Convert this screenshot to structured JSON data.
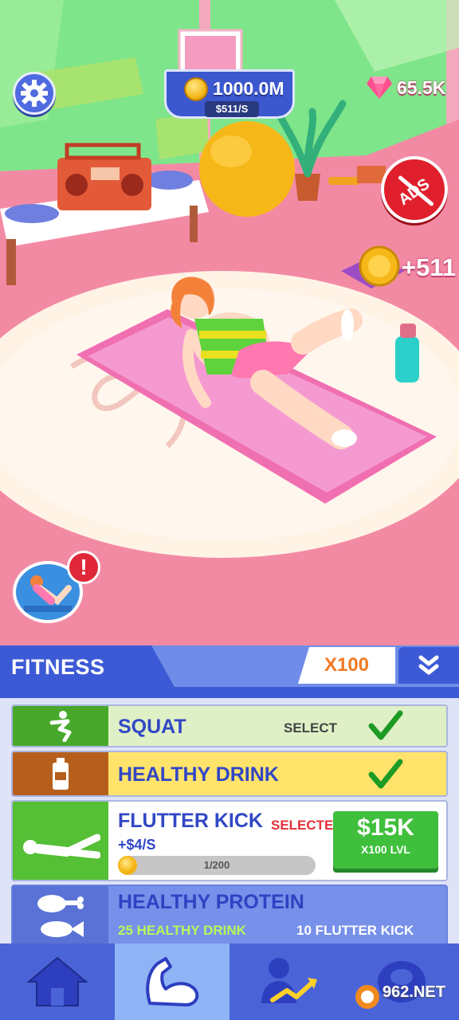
{
  "hud": {
    "coins": "1000.0M",
    "coins_per_second": "$511/S",
    "gems": "65.5K",
    "ads_label": "ADS",
    "income_popup": "+511"
  },
  "panel": {
    "tab_title": "FITNESS",
    "multiplier": "X100",
    "items": [
      {
        "name": "SQUAT",
        "status": "SELECT",
        "icon": "squat-icon",
        "color": "#47a82b"
      },
      {
        "name": "HEALTHY DRINK",
        "icon": "drink-bottle-icon",
        "color": "#b65f1c"
      },
      {
        "name": "FLUTTER KICK",
        "status": "SELECTED",
        "rate": "+$4/S",
        "progress_text": "1/200",
        "progress": 0.005,
        "price": "$15K",
        "price_sub": "X100 LVL",
        "icon": "flutter-kick-icon",
        "color": "#55bf35"
      },
      {
        "name": "HEALTHY PROTEIN",
        "requirement_1": "25 HEALTHY DRINK",
        "requirement_2": "10 FLUTTER KICK",
        "icon": "protein-food-icon",
        "color": "#5a72d6"
      }
    ]
  },
  "nav": [
    {
      "label": "home",
      "icon": "home-icon"
    },
    {
      "label": "fitness",
      "icon": "flexed-arm-icon",
      "active": true
    },
    {
      "label": "upgrades",
      "icon": "person-growth-icon"
    },
    {
      "label": "body",
      "icon": "body-icon"
    }
  ],
  "watermark": {
    "text": "962.NET"
  }
}
